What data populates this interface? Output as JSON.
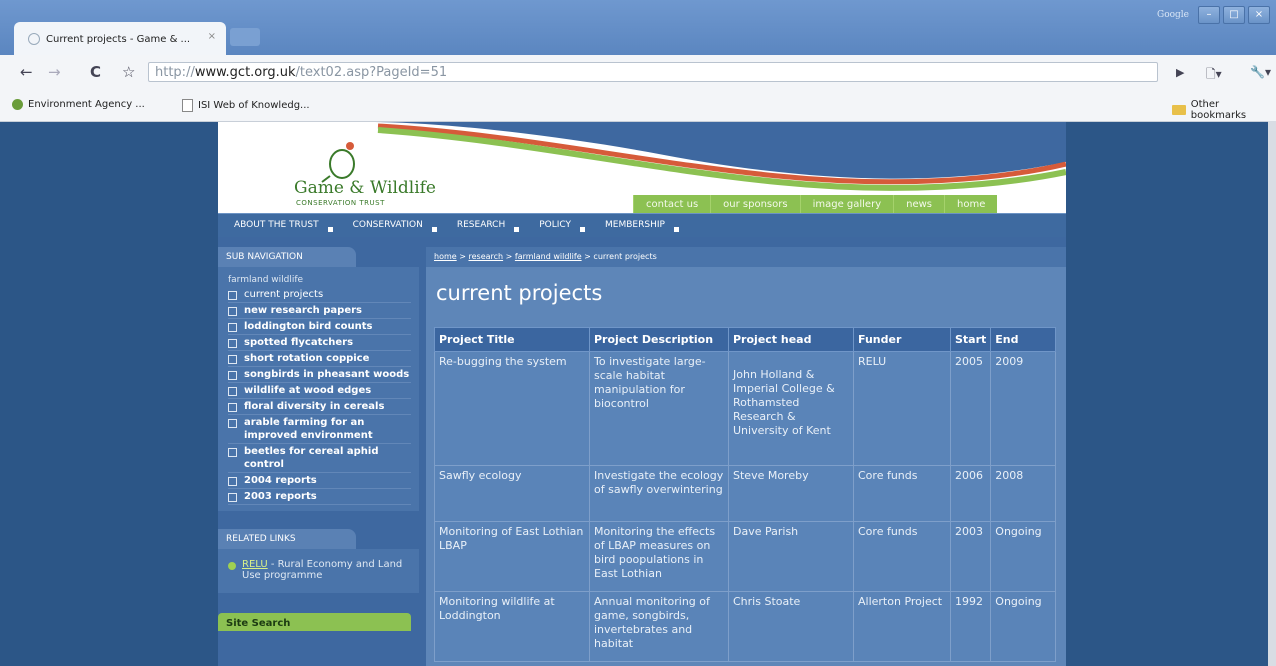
{
  "browser": {
    "tab_title": "Current projects - Game & ...",
    "tab_close": "×",
    "window_label": "Google",
    "url_scheme": "http://",
    "url_host": "www.gct.org.uk",
    "url_path": "/text02.asp?PageId=51",
    "bookmarks": [
      {
        "label": "Environment Agency ...",
        "icon": "environment-agency-icon"
      },
      {
        "label": "ISI Web of Knowledg...",
        "icon": "page-icon"
      }
    ],
    "other_bookmarks": "Other bookmarks",
    "nav_glyphs": {
      "back": "←",
      "forward": "→",
      "reload": "C",
      "star": "☆",
      "play": "▶",
      "page": "🗋▾",
      "wrench": "🔧▾"
    }
  },
  "site": {
    "logo_title": "Game & Wildlife",
    "logo_sub": "CONSERVATION TRUST",
    "top_links": [
      "contact us",
      "our sponsors",
      "image gallery",
      "news",
      "home"
    ],
    "main_nav": [
      "ABOUT THE TRUST",
      "CONSERVATION",
      "RESEARCH",
      "POLICY",
      "MEMBERSHIP"
    ],
    "colors": {
      "green": "#8cc152",
      "blue": "#3e68a0",
      "swoosh_red": "#d65b3a"
    }
  },
  "sidebar": {
    "heading": "SUB NAVIGATION",
    "section_title": "farmland wildlife",
    "items": [
      "current projects",
      "new research papers",
      "loddington bird counts",
      "spotted flycatchers",
      "short rotation coppice",
      "songbirds in pheasant woods",
      "wildlife at wood edges",
      "floral diversity in cereals",
      "arable farming for an improved environment",
      "beetles for cereal aphid control",
      "2004 reports",
      "2003 reports"
    ],
    "related_heading": "RELATED LINKS",
    "related_link": "RELU",
    "related_text": " - Rural Economy and Land Use programme",
    "search_heading": "Site Search"
  },
  "content": {
    "breadcrumb": [
      "home",
      "research",
      "farmland wildlife"
    ],
    "breadcrumb_sep": " > ",
    "breadcrumb_current": "current projects",
    "title": "current projects",
    "table": {
      "headers": [
        "Project Title",
        "Project Description",
        "Project head",
        "Funder",
        "Start",
        "End"
      ],
      "rows": [
        [
          "Re-bugging the system",
          "To investigate large-scale habitat manipulation for biocontrol",
          "John Holland & Imperial College & Rothamsted Research & University of Kent",
          "RELU",
          "2005",
          "2009"
        ],
        [
          "Sawfly ecology",
          "Investigate the ecology of sawfly overwintering",
          "Steve Moreby",
          "Core funds",
          "2006",
          "2008"
        ],
        [
          "Monitoring of East Lothian LBAP",
          "Monitoring the effects of LBAP measures on bird poopulations in East Lothian",
          "Dave Parish",
          "Core funds",
          "2003",
          "Ongoing"
        ],
        [
          "Monitoring wildlife at Loddington",
          "Annual monitoring of game, songbirds, invertebrates and habitat",
          "Chris Stoate",
          "Allerton Project",
          "1992",
          "Ongoing"
        ]
      ]
    }
  }
}
